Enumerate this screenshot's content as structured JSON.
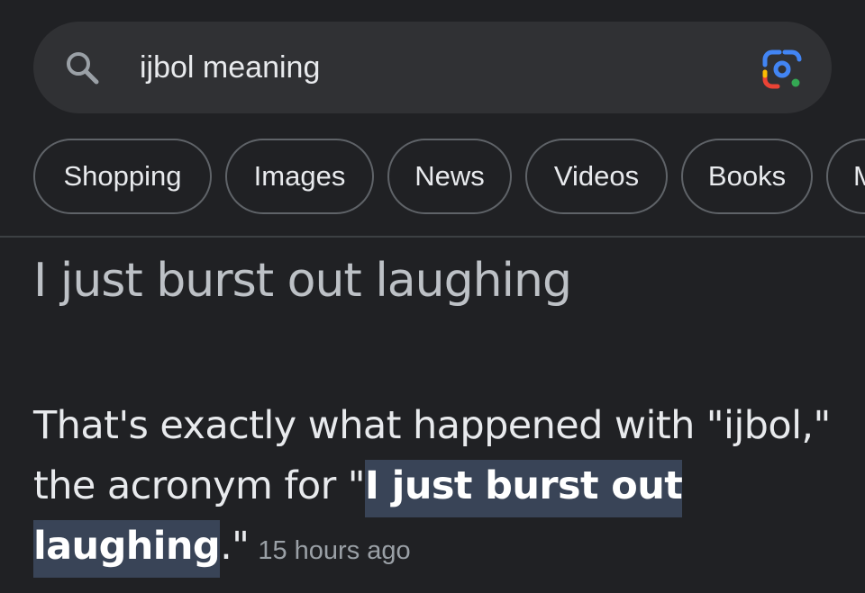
{
  "search": {
    "query": "ijbol meaning",
    "search_icon": "search-icon",
    "lens_icon": "google-lens-icon"
  },
  "chips": [
    {
      "label": "Shopping"
    },
    {
      "label": "Images"
    },
    {
      "label": "News"
    },
    {
      "label": "Videos"
    },
    {
      "label": "Books"
    },
    {
      "label": "M"
    }
  ],
  "result": {
    "title": "I just burst out laughing",
    "snippet_before": "That's exactly what happened with \"ijbol,\" the acronym for \"",
    "snippet_highlight_1": "I just burst out",
    "snippet_space": " ",
    "snippet_highlight_2": "laughing",
    "snippet_after": ".\"",
    "timestamp": "15 hours ago"
  },
  "colors": {
    "background": "#202124",
    "search_bar": "#303134",
    "highlight": "#394457",
    "lens_blue": "#4285f4",
    "lens_red": "#ea4335",
    "lens_yellow": "#fbbc04",
    "lens_green": "#34a853"
  }
}
